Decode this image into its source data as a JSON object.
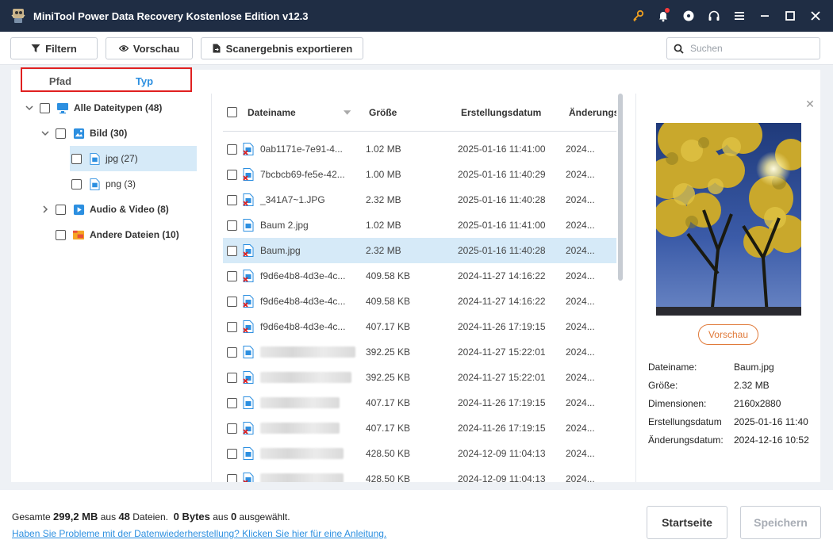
{
  "app": {
    "title": "MiniTool Power Data Recovery Kostenlose Edition v12.3",
    "titlebar_icons": [
      "key-icon",
      "bell-icon",
      "disc-icon",
      "headset-icon",
      "menu-icon",
      "minimize-icon",
      "maximize-icon",
      "close-icon"
    ]
  },
  "toolbar": {
    "filter_label": "Filtern",
    "preview_label": "Vorschau",
    "export_label": "Scanergebnis exportieren",
    "search_placeholder": "Suchen"
  },
  "tabs": {
    "path": "Pfad",
    "type": "Typ"
  },
  "tree": [
    {
      "label": "Alle Dateitypen (48)"
    },
    {
      "label": "Bild (30)"
    },
    {
      "label": "jpg (27)"
    },
    {
      "label": "png (3)"
    },
    {
      "label": "Audio & Video (8)"
    },
    {
      "label": "Andere Dateien (10)"
    }
  ],
  "columns": {
    "name": "Dateiname",
    "size": "Größe",
    "created": "Erstellungsdatum",
    "modified": "Änderungs"
  },
  "files": [
    {
      "name": "0ab1171e-7e91-4...",
      "size": "1.02 MB",
      "created": "2025-01-16 11:41:00",
      "modified": "2024..."
    },
    {
      "name": "7bcbcb69-fe5e-42...",
      "size": "1.00 MB",
      "created": "2025-01-16 11:40:29",
      "modified": "2024..."
    },
    {
      "name": "_341A7~1.JPG",
      "size": "2.32 MB",
      "created": "2025-01-16 11:40:28",
      "modified": "2024..."
    },
    {
      "name": "Baum 2.jpg",
      "size": "1.02 MB",
      "created": "2025-01-16 11:41:00",
      "modified": "2024..."
    },
    {
      "name": "Baum.jpg",
      "size": "2.32 MB",
      "created": "2025-01-16 11:40:28",
      "modified": "2024..."
    },
    {
      "name": "f9d6e4b8-4d3e-4c...",
      "size": "409.58 KB",
      "created": "2024-11-27 14:16:22",
      "modified": "2024..."
    },
    {
      "name": "f9d6e4b8-4d3e-4c...",
      "size": "409.58 KB",
      "created": "2024-11-27 14:16:22",
      "modified": "2024..."
    },
    {
      "name": "f9d6e4b8-4d3e-4c...",
      "size": "407.17 KB",
      "created": "2024-11-26 17:19:15",
      "modified": "2024..."
    },
    {
      "name": "",
      "size": "392.25 KB",
      "created": "2024-11-27 15:22:01",
      "modified": "2024..."
    },
    {
      "name": "",
      "size": "392.25 KB",
      "created": "2024-11-27 15:22:01",
      "modified": "2024..."
    },
    {
      "name": "",
      "size": "407.17 KB",
      "created": "2024-11-26 17:19:15",
      "modified": "2024..."
    },
    {
      "name": "",
      "size": "407.17 KB",
      "created": "2024-11-26 17:19:15",
      "modified": "2024..."
    },
    {
      "name": "",
      "size": "428.50 KB",
      "created": "2024-12-09 11:04:13",
      "modified": "2024..."
    },
    {
      "name": "",
      "size": "428.50 KB",
      "created": "2024-12-09 11:04:13",
      "modified": "2024..."
    }
  ],
  "preview": {
    "button_label": "Vorschau",
    "meta": [
      {
        "key": "Dateiname:",
        "value": "Baum.jpg"
      },
      {
        "key": "Größe:",
        "value": "2.32 MB"
      },
      {
        "key": "Dimensionen:",
        "value": "2160x2880"
      },
      {
        "key": "Erstellungsdatum",
        "value": "2025-01-16 11:40"
      },
      {
        "key": "Änderungsdatum:",
        "value": "2024-12-16 10:52"
      }
    ]
  },
  "footer": {
    "summary_prefix": "Gesamte",
    "total_size": "299,2 MB",
    "summary_mid": "aus",
    "total_files": "48",
    "summary_files": "Dateien.",
    "selected_size": "0 Bytes",
    "summary_mid2": "aus",
    "selected_count": "0",
    "summary_suffix": "ausgewählt.",
    "help_link": "Haben Sie Probleme mit der Datenwiederherstellung? Klicken Sie hier für eine Anleitung.",
    "home_button": "Startseite",
    "save_button": "Speichern"
  }
}
